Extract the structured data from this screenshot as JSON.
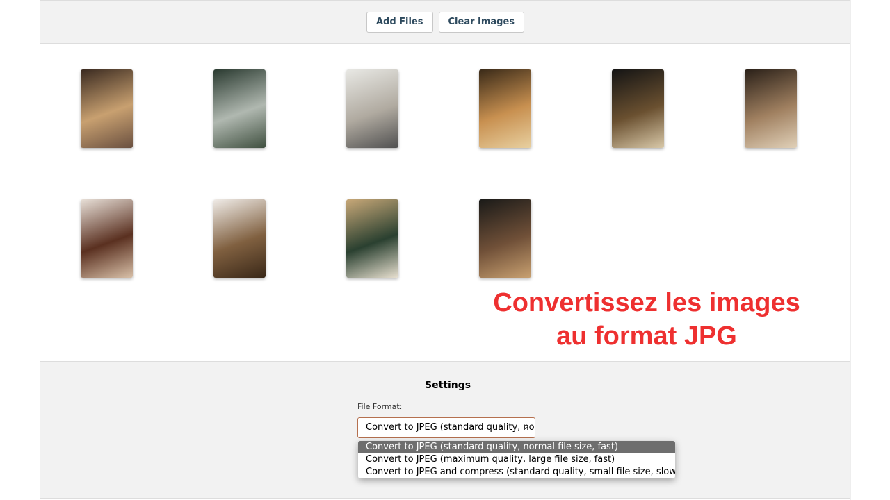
{
  "toolbar": {
    "add_files": "Add Files",
    "clear_images": "Clear Images"
  },
  "thumbnails": [
    {
      "name": "wine-shelf",
      "colors": [
        "#3a2a20",
        "#c8a070",
        "#6a5040"
      ]
    },
    {
      "name": "glass-tray",
      "colors": [
        "#2a3a30",
        "#b0b8b0",
        "#405040"
      ]
    },
    {
      "name": "coffee-tiles",
      "colors": [
        "#e8e8e4",
        "#b0aaa0",
        "#505050"
      ]
    },
    {
      "name": "drink-board",
      "colors": [
        "#3a2a18",
        "#c89050",
        "#e8d0a0"
      ]
    },
    {
      "name": "latte-croissant",
      "colors": [
        "#141414",
        "#6a5030",
        "#d8c8a8"
      ]
    },
    {
      "name": "cafe-chairs",
      "colors": [
        "#2a2018",
        "#a08060",
        "#e0d0b8"
      ]
    },
    {
      "name": "donut",
      "colors": [
        "#e8e0d8",
        "#5a3020",
        "#d8c0a8"
      ]
    },
    {
      "name": "pastry-counter",
      "colors": [
        "#f0ece8",
        "#806040",
        "#3a2818"
      ]
    },
    {
      "name": "cake-plate",
      "colors": [
        "#c8a878",
        "#2a4030",
        "#e8e0d0"
      ]
    },
    {
      "name": "glasses-table",
      "colors": [
        "#1a1a18",
        "#705038",
        "#c8a070"
      ]
    }
  ],
  "overlay": {
    "line1": "Convertissez les images",
    "line2": "au format JPG"
  },
  "settings": {
    "title": "Settings",
    "file_format_label": "File Format:",
    "selected": "Convert to JPEG (standard quality, normal file size, fast)",
    "options": [
      "Convert to JPEG (standard quality, normal file size, fast)",
      "Convert to JPEG (maximum quality, large file size, fast)",
      "Convert to JPEG and compress (standard quality, small file size, slow)"
    ]
  }
}
